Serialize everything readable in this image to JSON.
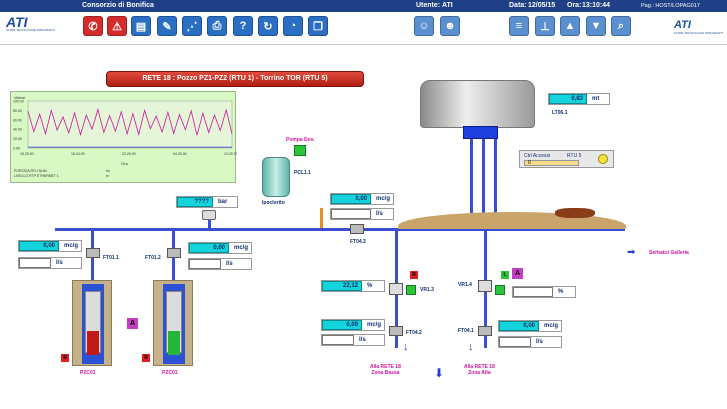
{
  "topbar": {
    "app": "Consorzio di Bonifica",
    "user_label": "Utente:",
    "user": "ATI",
    "date_label": "Data:",
    "date": "12/05/15",
    "time_label": "Ora:",
    "time": "13:10:44",
    "page": "Pag.: HOST/LOPAG017"
  },
  "toolbar": {
    "icons": [
      "phone-icon",
      "alarm-icon",
      "report-icon",
      "edit-icon",
      "trend-icon",
      "print-icon",
      "help-icon",
      "history-icon",
      "gauge-icon",
      "docs-icon",
      "user-icon",
      "users-icon",
      "list-icon",
      "tree-icon",
      "up-icon",
      "down-icon",
      "search-icon"
    ]
  },
  "logo": {
    "text": "ATI",
    "sub": "ALTRE TECNOLOGIE INTEGRANTI"
  },
  "title": "RETE 18 : Pozzo  PZ1-PZ2 (RTU 1) - Torrino TOR (RTU 5)",
  "chart": {
    "ylabel": "Valore",
    "legend_1": "PORTATA RTU NUM.",
    "legend_2": "LIVELLO RTP ETHERNET 1",
    "legend_vals": [
      "I/s",
      "m"
    ],
    "xlabel": "Ora",
    "yticks": [
      "100.00",
      "80.00",
      "60.00",
      "40.00",
      "20.00",
      "0.00"
    ],
    "xticks": [
      "15.29.00",
      "16.24.00",
      "22.29.00",
      "04.29.00",
      "10.29.00"
    ]
  },
  "chart_data": {
    "type": "line",
    "ylim": [
      0,
      100
    ],
    "series": [
      {
        "values": [
          78,
          35,
          72,
          30,
          80,
          38,
          66,
          32,
          75,
          28,
          70,
          40,
          82,
          33,
          69,
          36,
          77,
          30,
          73,
          29,
          80,
          41,
          68,
          34,
          76,
          31,
          71,
          39,
          79,
          27,
          74,
          33,
          70,
          37,
          81,
          30
        ]
      },
      {
        "values": [
          2,
          2,
          2,
          2,
          2,
          2,
          2,
          2,
          2,
          2,
          2,
          2,
          2,
          2,
          2,
          2,
          2,
          2,
          2,
          2,
          2,
          2,
          2,
          2,
          2,
          2,
          2,
          2,
          2,
          2,
          2,
          2,
          2,
          2,
          2,
          2
        ]
      }
    ]
  },
  "pressure_main": {
    "value": "????",
    "unit": "bar"
  },
  "ft01_1": {
    "label": "FT01.1",
    "pressure": "0,00",
    "p_unit": "mc/g",
    "flow": "",
    "f_unit": "l/s"
  },
  "ft01_2": {
    "label": "FT01.2",
    "pressure": "0,00",
    "p_unit": "mc/g",
    "flow": "",
    "f_unit": "l/s"
  },
  "ft04_3": {
    "label": "FT04.3",
    "pressure": "0,00",
    "p_unit": "mc/g",
    "flow": "",
    "f_unit": "l/s"
  },
  "pompa": {
    "title": "Pompa Dos.",
    "label": "PCL1.1",
    "tank": "Ipoclorito"
  },
  "tower": {
    "level": "0,83",
    "unit": "mt",
    "label": "LT06.1"
  },
  "ctrl": {
    "label": "Ctrl Accessi",
    "rtu": "RTU 5",
    "value": "0"
  },
  "vr1_3": {
    "label": "VR1.3",
    "value": "22,12",
    "unit": "%"
  },
  "vr1_4": {
    "label": "VR1.4",
    "value": "",
    "unit": "%"
  },
  "ft04_2": {
    "label": "FT04.2",
    "pressure": "0,00",
    "p_unit": "mc/g",
    "flow": "",
    "f_unit": "l/s"
  },
  "ft04_1": {
    "label": "FT04.1",
    "pressure": "0,00",
    "p_unit": "mc/g",
    "flow": "",
    "f_unit": "l/s"
  },
  "serbatoi": "Serbatoi Galleria",
  "zona_bassa": {
    "l1": "Alla RETE  18",
    "l2": "Zona Bassa"
  },
  "zona_alta": {
    "l1": "Alla RETE  18",
    "l2": "Zona Alta"
  },
  "wells": [
    {
      "label": "PZC01"
    },
    {
      "label": "PZC01"
    }
  ],
  "badges": {
    "r": "R",
    "a": "A",
    "l": "L"
  }
}
